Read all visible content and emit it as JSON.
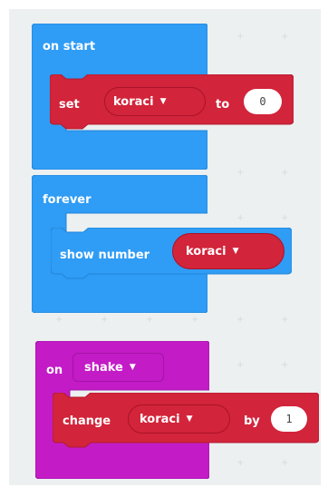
{
  "on_start_block": {
    "label": "on start",
    "color": "#2f9cf5",
    "set_block": {
      "label": "set",
      "variable": "koraci",
      "to_label": "to",
      "value": "0",
      "color": "#d2243a"
    }
  },
  "forever_block": {
    "label": "forever",
    "color": "#2f9cf5",
    "show_number_block": {
      "label": "show number",
      "variable": "koraci",
      "variable_color": "#d2243a"
    }
  },
  "on_shake_block": {
    "label": "on",
    "gesture": "shake",
    "color": "#c31bc6",
    "change_block": {
      "label": "change",
      "variable": "koraci",
      "by_label": "by",
      "value": "1",
      "color": "#d2243a"
    }
  },
  "dropdown_icon": "triangle-down",
  "workspace_background": "#ecf0f1"
}
